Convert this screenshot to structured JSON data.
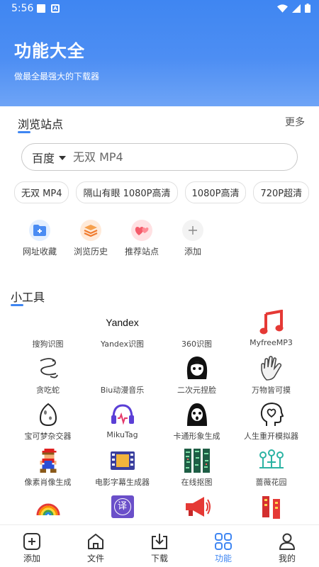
{
  "status": {
    "time": "5:56"
  },
  "header": {
    "title": "功能大全",
    "subtitle": "做最全最强大的下载器"
  },
  "browse": {
    "title": "浏览站点",
    "more": "更多",
    "search": {
      "engine": "百度",
      "placeholder": "无双 MP4"
    },
    "chips": [
      "无双 MP4",
      "隔山有眼 1080P高清",
      "1080P高清",
      "720P超清"
    ],
    "shortcuts": [
      {
        "label": "网址收藏",
        "icon": "bookmark-folder-icon"
      },
      {
        "label": "浏览历史",
        "icon": "history-layers-icon"
      },
      {
        "label": "推荐站点",
        "icon": "hearts-icon"
      },
      {
        "label": "添加",
        "icon": "plus-icon"
      }
    ]
  },
  "tools": {
    "title": "小工具",
    "items": [
      {
        "label": "搜狗识图",
        "icon": "blank-icon"
      },
      {
        "label": "Yandex识图",
        "icon": "yandex-logo-icon",
        "icon_text": "Yandex"
      },
      {
        "label": "360识图",
        "icon": "blank-icon"
      },
      {
        "label": "MyfreeMP3",
        "icon": "music-note-icon"
      },
      {
        "label": "贪吃蛇",
        "icon": "snake-icon"
      },
      {
        "label": "Biu动漫音乐",
        "icon": "blank-icon"
      },
      {
        "label": "二次元捏脸",
        "icon": "anime-face-icon"
      },
      {
        "label": "万物皆可摸",
        "icon": "hand-icon"
      },
      {
        "label": "宝可梦杂交器",
        "icon": "egg-icon"
      },
      {
        "label": "MikuTag",
        "icon": "headphones-icon"
      },
      {
        "label": "卡通形象生成",
        "icon": "ghost-icon"
      },
      {
        "label": "人生重开模拟器",
        "icon": "heart-head-icon"
      },
      {
        "label": "像素肖像生成",
        "icon": "pixel-mario-icon"
      },
      {
        "label": "电影字幕生成器",
        "icon": "film-icon"
      },
      {
        "label": "在线抠图",
        "icon": "cutout-icon"
      },
      {
        "label": "蔷薇花园",
        "icon": "garden-icon"
      },
      {
        "label": "",
        "icon": "rainbow-icon"
      },
      {
        "label": "",
        "icon": "translate-icon",
        "icon_text": "译"
      },
      {
        "label": "",
        "icon": "megaphone-icon"
      },
      {
        "label": "",
        "icon": "couplet-icon"
      }
    ]
  },
  "nav": [
    {
      "label": "添加",
      "icon": "add-square-icon"
    },
    {
      "label": "文件",
      "icon": "home-folder-icon"
    },
    {
      "label": "下载",
      "icon": "download-icon"
    },
    {
      "label": "功能",
      "icon": "grid-icon",
      "active": true
    },
    {
      "label": "我的",
      "icon": "person-icon"
    }
  ],
  "colors": {
    "accent": "#3f86f2",
    "header": "#4a8cf3"
  }
}
